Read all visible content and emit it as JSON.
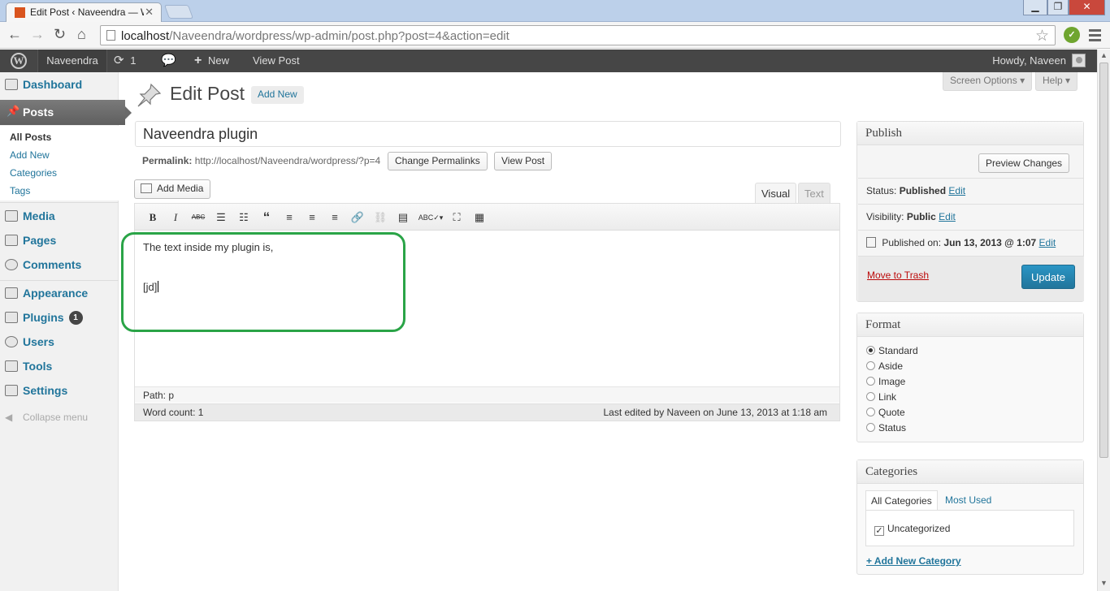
{
  "browser": {
    "tab_title": "Edit Post ‹ Naveendra — W",
    "url_host": "localhost",
    "url_path": "/Naveendra/wordpress/wp-admin/post.php?post=4&action=edit"
  },
  "adminbar": {
    "site_name": "Naveendra",
    "updates_count": "1",
    "new_label": "New",
    "view_post_label": "View Post",
    "howdy": "Howdy, Naveen"
  },
  "sidebar": {
    "dashboard": "Dashboard",
    "posts": "Posts",
    "posts_sub": [
      "All Posts",
      "Add New",
      "Categories",
      "Tags"
    ],
    "media": "Media",
    "pages": "Pages",
    "comments": "Comments",
    "appearance": "Appearance",
    "plugins": "Plugins",
    "plugins_badge": "1",
    "users": "Users",
    "tools": "Tools",
    "settings": "Settings",
    "collapse": "Collapse menu"
  },
  "header": {
    "title": "Edit Post",
    "add_new": "Add New",
    "screen_options": "Screen Options",
    "help": "Help"
  },
  "post": {
    "title": "Naveendra plugin",
    "permalink_label": "Permalink:",
    "permalink_url": "http://localhost/Naveendra/wordpress/?p=4",
    "change_permalinks": "Change Permalinks",
    "view_post": "View Post",
    "add_media": "Add Media",
    "tab_visual": "Visual",
    "tab_text": "Text",
    "content_line1": "The text inside my plugin is,",
    "content_line2": "[jd]",
    "path": "Path: p",
    "word_count": "Word count: 1",
    "last_edited": "Last edited by Naveen on June 13, 2013 at 1:18 am"
  },
  "toolbar_icons": [
    "bold-icon",
    "italic-icon",
    "strikethrough-icon",
    "bullet-list-icon",
    "numbered-list-icon",
    "blockquote-icon",
    "align-left-icon",
    "align-center-icon",
    "align-right-icon",
    "link-icon",
    "unlink-icon",
    "more-tag-icon",
    "spellcheck-icon",
    "fullscreen-icon",
    "kitchen-sink-icon"
  ],
  "publish": {
    "heading": "Publish",
    "preview_changes": "Preview Changes",
    "status_label": "Status:",
    "status_value": "Published",
    "visibility_label": "Visibility:",
    "visibility_value": "Public",
    "published_on_label": "Published on:",
    "published_on_value": "Jun 13, 2013 @ 1:07",
    "edit": "Edit",
    "move_to_trash": "Move to Trash",
    "update": "Update"
  },
  "format": {
    "heading": "Format",
    "options": [
      "Standard",
      "Aside",
      "Image",
      "Link",
      "Quote",
      "Status"
    ],
    "selected": "Standard"
  },
  "categories": {
    "heading": "Categories",
    "tab_all": "All Categories",
    "tab_most_used": "Most Used",
    "items": [
      "Uncategorized"
    ],
    "add_new": "+ Add New Category"
  },
  "colors": {
    "link": "#21759b",
    "adminbar": "#464646",
    "highlight": "#2aa447",
    "update_button": "#21759b",
    "trash": "#bc0b0b"
  }
}
